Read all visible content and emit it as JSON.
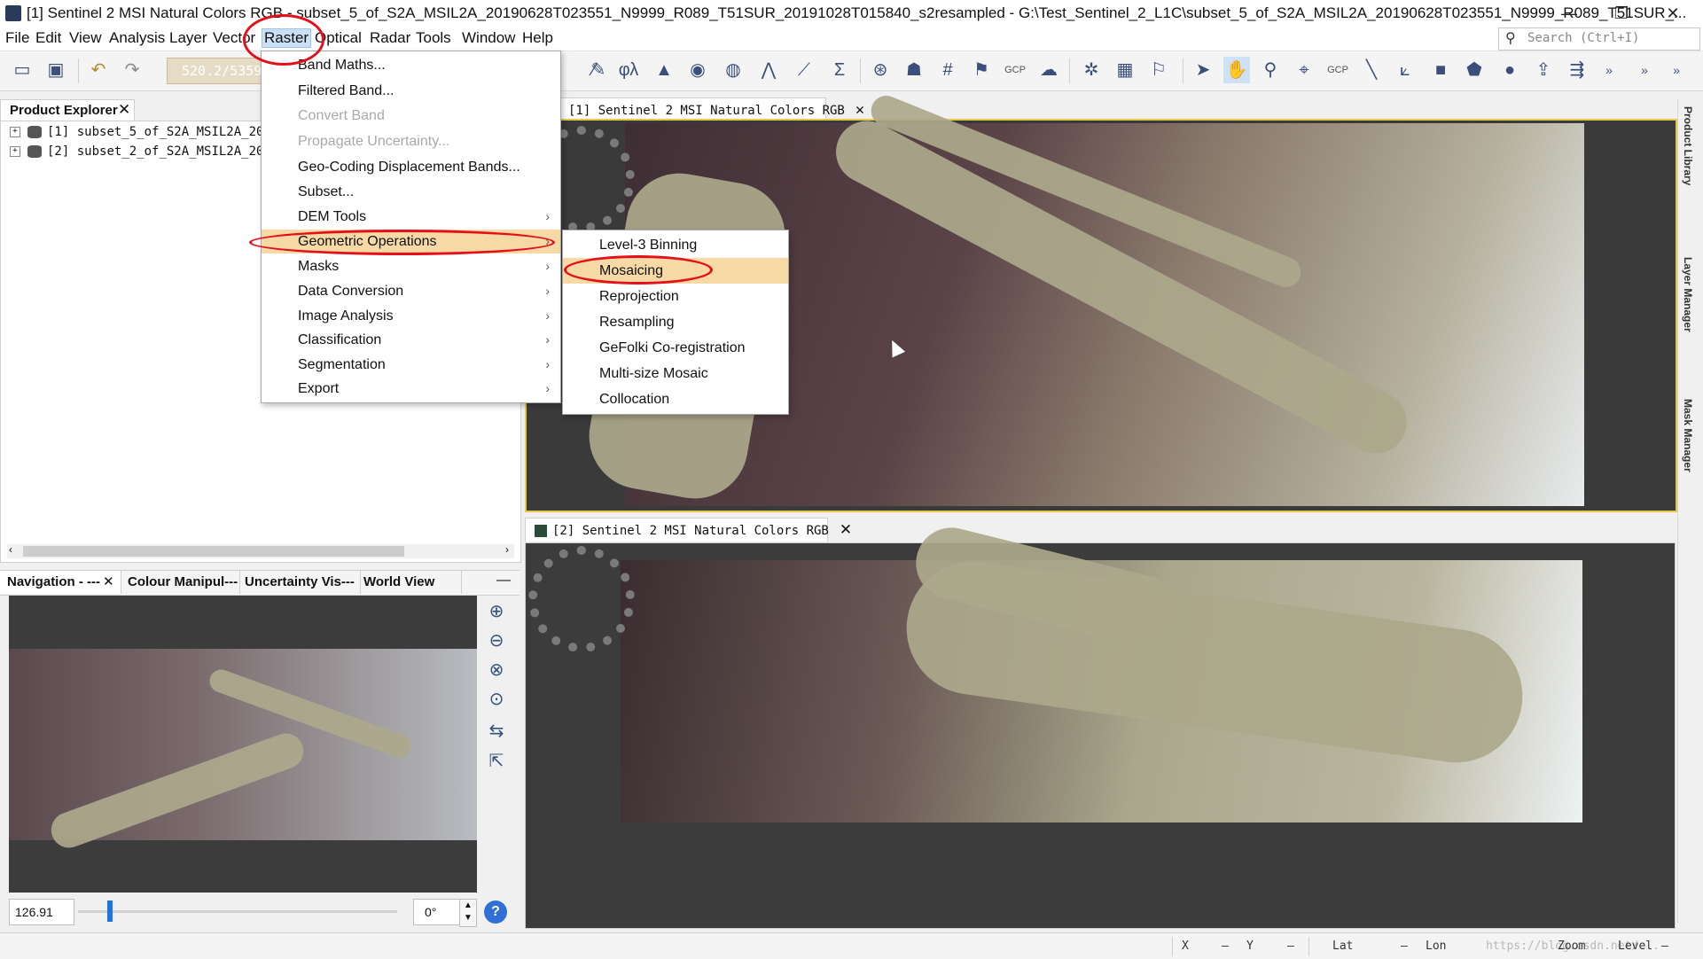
{
  "window": {
    "title": "[1] Sentinel 2 MSI Natural Colors RGB - subset_5_of_S2A_MSIL2A_20190628T023551_N9999_R089_T51SUR_20191028T015840_s2resampled - G:\\Test_Sentinel_2_L1C\\subset_5_of_S2A_MSIL2A_20190628T023551_N9999_R089_T51SUR_...",
    "minimize": "—",
    "restore": "❐",
    "close": "✕"
  },
  "menubar": {
    "items": [
      "File",
      "Edit",
      "View",
      "Analysis",
      "Layer",
      "Vector",
      "Raster",
      "Optical",
      "Radar",
      "Tools",
      "Window",
      "Help"
    ],
    "active": "Raster",
    "search_placeholder": "Search (Ctrl+I)"
  },
  "toolbar": {
    "coord_value": "520.2/5359",
    "icons": [
      "open-product-icon",
      "save-icon",
      "undo-icon",
      "redo-icon",
      "band-maths-icon",
      "spectrum-icon",
      "histogram-icon",
      "scatter-icon",
      "statistics-icon",
      "gcp-icon",
      "pin-icon",
      "select-tool-icon",
      "pan-tool-icon",
      "zoom-tool-icon",
      "range-finder-icon",
      "line-draw-icon",
      "polyline-draw-icon",
      "rectangle-draw-icon",
      "polygon-draw-icon",
      "ellipse-draw-icon",
      "insert-icon",
      "import-icon"
    ]
  },
  "product_explorer": {
    "tab_label": "Product Explorer",
    "close": "✕",
    "items": [
      {
        "index": "[1]",
        "name": "subset_5_of_S2A_MSIL2A_2019"
      },
      {
        "index": "[2]",
        "name": "subset_2_of_S2A_MSIL2A_2019"
      }
    ]
  },
  "navigation": {
    "tabs": [
      "Navigation - ---",
      "Colour Manipul---",
      "Uncertainty Vis---",
      "World View"
    ],
    "tab_close": "✕",
    "minimize": "—",
    "zoom_value": "126.91",
    "rotation_value": "0°",
    "help": "?"
  },
  "views": {
    "view1_tab": "[1] Sentinel 2 MSI Natural Colors RGB",
    "view2_tab": "[2] Sentinel 2 MSI Natural Colors RGB",
    "close": "✕"
  },
  "right_dock": [
    "Product Library",
    "Layer Manager",
    "Mask Manager"
  ],
  "raster_menu": [
    {
      "label": "Band Maths...",
      "disabled": false,
      "submenu": false
    },
    {
      "label": "Filtered Band...",
      "disabled": false,
      "submenu": false
    },
    {
      "label": "Convert Band",
      "disabled": true,
      "submenu": false
    },
    {
      "label": "Propagate Uncertainty...",
      "disabled": true,
      "submenu": false
    },
    {
      "label": "Geo-Coding Displacement Bands...",
      "disabled": false,
      "submenu": false
    },
    {
      "label": "Subset...",
      "disabled": false,
      "submenu": false
    },
    {
      "label": "DEM Tools",
      "disabled": false,
      "submenu": true
    },
    {
      "label": "Geometric Operations",
      "disabled": false,
      "submenu": true,
      "highlighted": true
    },
    {
      "label": "Masks",
      "disabled": false,
      "submenu": true
    },
    {
      "label": "Data Conversion",
      "disabled": false,
      "submenu": true
    },
    {
      "label": "Image Analysis",
      "disabled": false,
      "submenu": true
    },
    {
      "label": "Classification",
      "disabled": false,
      "submenu": true
    },
    {
      "label": "Segmentation",
      "disabled": false,
      "submenu": true
    },
    {
      "label": "Export",
      "disabled": false,
      "submenu": true
    }
  ],
  "geometric_menu": [
    {
      "label": "Level-3 Binning"
    },
    {
      "label": "Mosaicing",
      "highlighted": true
    },
    {
      "label": "Reprojection"
    },
    {
      "label": "Resampling"
    },
    {
      "label": "GeFolki Co-registration"
    },
    {
      "label": "Multi-size Mosaic"
    },
    {
      "label": "Collocation"
    }
  ],
  "statusbar": {
    "x_label": "X",
    "x_value": "—",
    "y_label": "Y",
    "y_value": "—",
    "lat_label": "Lat",
    "lat_value": "—",
    "lon_label": "Lon",
    "zoom_label": "Zoom",
    "level_label": "Level",
    "level_value": "—",
    "watermark": "https://blog.csdn.net/..."
  },
  "colors": {
    "highlight": "#f7d9a6",
    "annotation_red": "#e3101a",
    "view_selected_border": "#e8c84a"
  }
}
